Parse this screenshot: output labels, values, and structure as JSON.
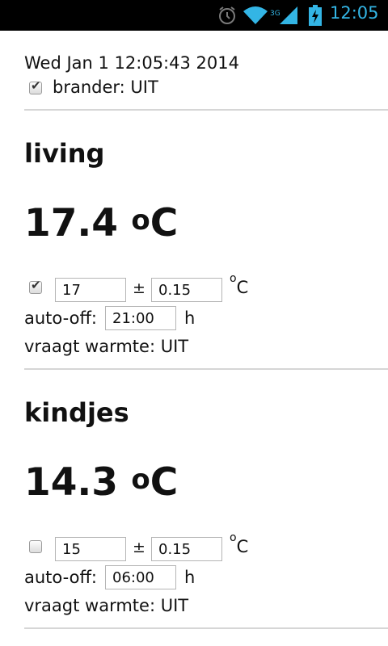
{
  "status_bar": {
    "time": "12:05",
    "network": "3G"
  },
  "datetime": "Wed Jan 1 12:05:43 2014",
  "burner": {
    "label": "brander: UIT",
    "checked": true
  },
  "zones": [
    {
      "name": "living",
      "temperature": "17.4",
      "temp_unit": "C",
      "temp_unit_sup": "o",
      "enabled": true,
      "setpoint": "17",
      "plusminus": "±",
      "tolerance": "0.15",
      "unit_sup": "o",
      "unit": "C",
      "auto_off_label": "auto-off:",
      "auto_off": "21:00",
      "auto_off_unit": "h",
      "heat_request": "vraagt warmte: UIT"
    },
    {
      "name": "kindjes",
      "temperature": "14.3",
      "temp_unit": "C",
      "temp_unit_sup": "o",
      "enabled": false,
      "setpoint": "15",
      "plusminus": "±",
      "tolerance": "0.15",
      "unit_sup": "o",
      "unit": "C",
      "auto_off_label": "auto-off:",
      "auto_off": "06:00",
      "auto_off_unit": "h",
      "heat_request": "vraagt warmte: UIT"
    }
  ]
}
